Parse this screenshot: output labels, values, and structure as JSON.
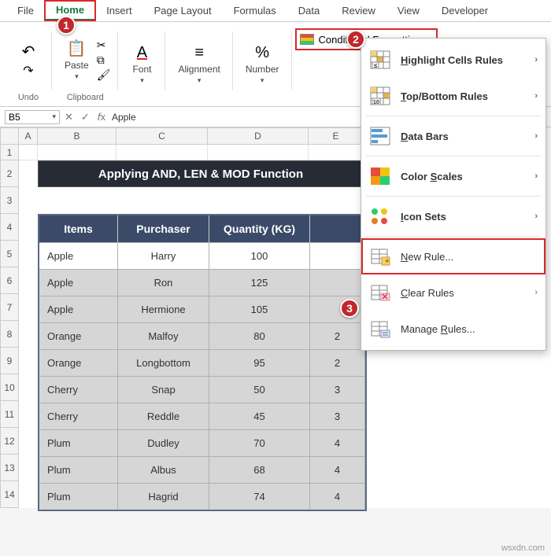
{
  "tabs": [
    "File",
    "Home",
    "Insert",
    "Page Layout",
    "Formulas",
    "Data",
    "Review",
    "View",
    "Developer"
  ],
  "ribbon": {
    "groups": {
      "undo": "Undo",
      "clipboard": "Clipboard",
      "paste": "Paste",
      "font": "Font",
      "alignment": "Alignment",
      "number": "Number"
    },
    "cond_fmt": "Conditional Formatting"
  },
  "namebox": "B5",
  "formula": "Apple",
  "columns": [
    "A",
    "B",
    "C",
    "D",
    "E"
  ],
  "rows": [
    "1",
    "2",
    "3",
    "4",
    "5",
    "6",
    "7",
    "8",
    "9",
    "10",
    "11",
    "12",
    "13",
    "14"
  ],
  "banner": "Applying AND, LEN & MOD Function",
  "table": {
    "headers": [
      "Items",
      "Purchaser",
      "Quantity (KG)",
      ""
    ],
    "rows": [
      [
        "Apple",
        "Harry",
        "100",
        ""
      ],
      [
        "Apple",
        "Ron",
        "125",
        ""
      ],
      [
        "Apple",
        "Hermione",
        "105",
        ""
      ],
      [
        "Orange",
        "Malfoy",
        "80",
        "2"
      ],
      [
        "Orange",
        "Longbottom",
        "95",
        "2"
      ],
      [
        "Cherry",
        "Snap",
        "50",
        "3"
      ],
      [
        "Cherry",
        "Reddle",
        "45",
        "3"
      ],
      [
        "Plum",
        "Dudley",
        "70",
        "4"
      ],
      [
        "Plum",
        "Albus",
        "68",
        "4"
      ],
      [
        "Plum",
        "Hagrid",
        "74",
        "4"
      ]
    ]
  },
  "dropdown": {
    "items": [
      "Highlight Cells Rules",
      "Top/Bottom Rules",
      "Data Bars",
      "Color Scales",
      "Icon Sets",
      "New Rule...",
      "Clear Rules",
      "Manage Rules..."
    ]
  },
  "callouts": [
    "1",
    "2",
    "3"
  ],
  "watermark": "wsxdn.com"
}
